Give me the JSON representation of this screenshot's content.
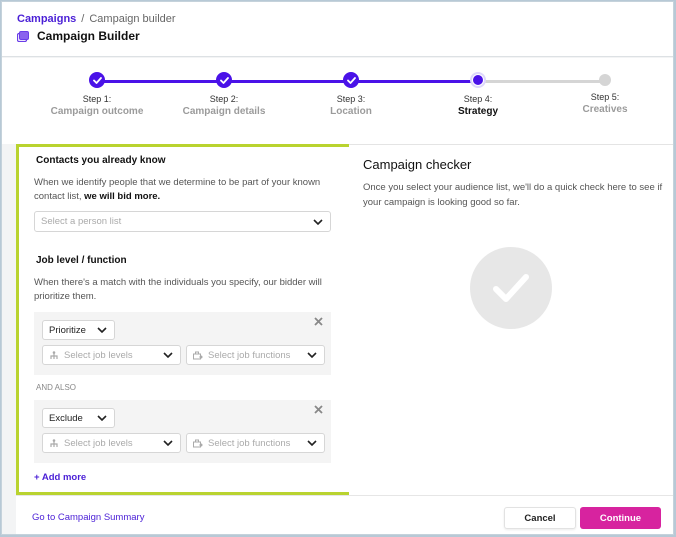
{
  "header": {
    "breadcrumb": {
      "parent": "Campaigns",
      "separator": "/",
      "current": "Campaign builder"
    },
    "title": "Campaign Builder",
    "title_icon": "campaign-icon"
  },
  "stepper": {
    "colors": {
      "done": "#4a12e8",
      "todo": "#d5d5d5"
    },
    "steps": [
      {
        "number": "Step 1:",
        "name": "Campaign outcome",
        "state": "done"
      },
      {
        "number": "Step 2:",
        "name": "Campaign details",
        "state": "done"
      },
      {
        "number": "Step 3:",
        "name": "Location",
        "state": "done"
      },
      {
        "number": "Step 4:",
        "name": "Strategy",
        "state": "current"
      },
      {
        "number": "Step 5:",
        "name": "Creatives",
        "state": "todo"
      }
    ]
  },
  "contacts": {
    "title": "Contacts you already know",
    "desc_plain": "When we identify people that we determine to be part of your known contact list, ",
    "desc_bold": "we will bid more.",
    "select_placeholder": "Select a person list"
  },
  "job": {
    "title": "Job level / function",
    "desc": "When there's a match with the individuals you specify, our bidder will prioritize them.",
    "rules": [
      {
        "mode": "Prioritize",
        "levels_placeholder": "Select job levels",
        "functions_placeholder": "Select job functions"
      },
      {
        "mode": "Exclude",
        "levels_placeholder": "Select job levels",
        "functions_placeholder": "Select job functions"
      }
    ],
    "and_also": "AND ALSO",
    "add_more": "+ Add more"
  },
  "checker": {
    "title": "Campaign checker",
    "desc": "Once you select your audience list, we'll do a quick check here to see if your campaign is looking good so far."
  },
  "footer": {
    "summary_link": "Go to Campaign Summary",
    "cancel": "Cancel",
    "continue": "Continue",
    "continue_color": "#d7239f"
  },
  "highlight_color": "#b9d32f"
}
